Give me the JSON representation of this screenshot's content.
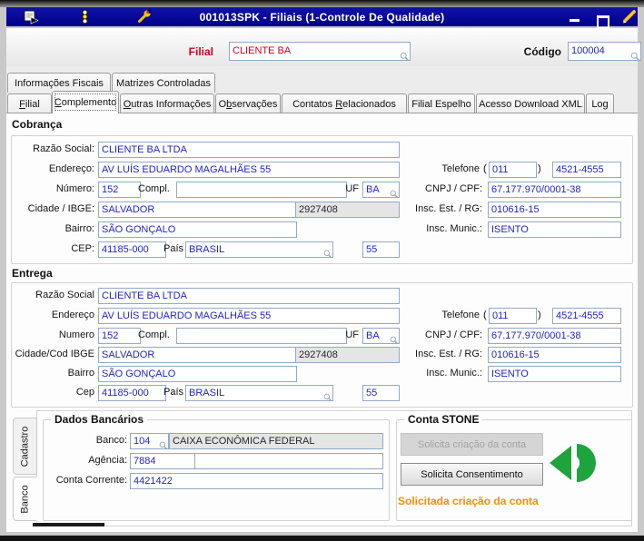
{
  "window": {
    "title": "001013SPK - Filiais (1-Controle De Qualidade)",
    "icons_left": [
      "form-icon",
      "traffic-light-icon",
      "wrench-icon"
    ],
    "icons_right": [
      "minimize-icon",
      "maximize-icon",
      "pencil-icon"
    ]
  },
  "header": {
    "filial_label": "Filial",
    "filial_value": "CLIENTE BA",
    "codigo_label": "Código",
    "codigo_value": "100004"
  },
  "tabs_top": [
    "Informações Fiscais",
    "Matrizes Controladas"
  ],
  "tabs_main": [
    {
      "pre": "",
      "key": "F",
      "post": "ilial",
      "selected": false
    },
    {
      "pre": "",
      "key": "C",
      "post": "omplemento",
      "selected": true
    },
    {
      "pre": "",
      "key": "O",
      "post": "utras Informações",
      "selected": false
    },
    {
      "pre": "O",
      "key": "b",
      "post": "servações",
      "selected": false
    },
    {
      "pre": "Contatos ",
      "key": "R",
      "post": "elacionados",
      "selected": false
    },
    {
      "pre": "Filial Espelho",
      "key": "",
      "post": "",
      "selected": false
    },
    {
      "pre": "Acesso Download XML",
      "key": "",
      "post": "",
      "selected": false
    },
    {
      "pre": "Log",
      "key": "",
      "post": "",
      "selected": false
    }
  ],
  "cobranca": {
    "title": "Cobrança",
    "razao_label": "Razão Social:",
    "razao": "CLIENTE BA LTDA",
    "endereco_label": "Endereço:",
    "endereco": "AV LUÍS EDUARDO MAGALHÃES 55",
    "numero_label": "Número:",
    "numero": "152",
    "compl_label": "Compl.",
    "compl": "",
    "uf_label": "UF",
    "uf": "BA",
    "cidade_label": "Cidade / IBGE:",
    "cidade": "SALVADOR",
    "ibge": "2927408",
    "bairro_label": "Bairro:",
    "bairro": "SÃO GONÇALO",
    "cep_label": "CEP:",
    "cep": "41185-000",
    "pais_label": "País",
    "pais": "BRASIL",
    "pais_cod": "55",
    "telefone_label": "Telefone",
    "paren_open": "(",
    "paren_close": ")",
    "ddd": "011",
    "telefone": "4521-4555",
    "cnpj_label": "CNPJ / CPF:",
    "cnpj": "67.177.970/0001-38",
    "insc_est_label": "Insc. Est. / RG:",
    "insc_est": "010616-15",
    "insc_mun_label": "Insc. Munic.:",
    "insc_mun": "ISENTO"
  },
  "entrega": {
    "title": "Entrega",
    "razao_label": "Razão Social",
    "razao": "CLIENTE BA LTDA",
    "endereco_label": "Endereço",
    "endereco": "AV LUÍS EDUARDO MAGALHÃES 55",
    "numero_label": "Numero",
    "numero": "152",
    "compl_label": "Compl.",
    "compl": "",
    "uf_label": "UF",
    "uf": "BA",
    "cidade_label": "Cidade/Cod IBGE",
    "cidade": "SALVADOR",
    "ibge": "2927408",
    "bairro_label": "Bairro",
    "bairro": "SÃO GONÇALO",
    "cep_label": "Cep",
    "cep": "41185-000",
    "pais_label": "País",
    "pais": "BRASIL",
    "pais_cod": "55",
    "telefone_label": "Telefone",
    "paren_open": "(",
    "paren_close": ")",
    "ddd": "011",
    "telefone": "4521-4555",
    "cnpj_label": "CNPJ / CPF:",
    "cnpj": "67.177.970/0001-38",
    "insc_est_label": "Insc. Est. / RG:",
    "insc_est": "010616-15",
    "insc_mun_label": "Insc. Munic.:",
    "insc_mun": "ISENTO"
  },
  "sidebar_tabs": [
    "Cadastro",
    "Banco"
  ],
  "dados_bancarios": {
    "title": "Dados Bancários",
    "banco_label": "Banco:",
    "banco_cod": "104",
    "banco_nome": "CAIXA ECONÔMICA FEDERAL",
    "agencia_label": "Agência:",
    "agencia": "7884",
    "agencia_extra": "",
    "conta_label": "Conta Corrente:",
    "conta": "4421422"
  },
  "conta_stone": {
    "title": "Conta STONE",
    "btn_criacao": "Solicita criação da conta",
    "btn_consentimento": "Solicita Consentimento",
    "status": "Solicitada criação da conta",
    "stone_icon": "stone-logo-icon"
  },
  "colors": {
    "titlebar": "#00008b",
    "value_blue": "#2323cc",
    "filial_red": "#d40022",
    "status_orange": "#ff8c00",
    "stone_green": "#1ea43c",
    "input_border": "#93aac6"
  }
}
